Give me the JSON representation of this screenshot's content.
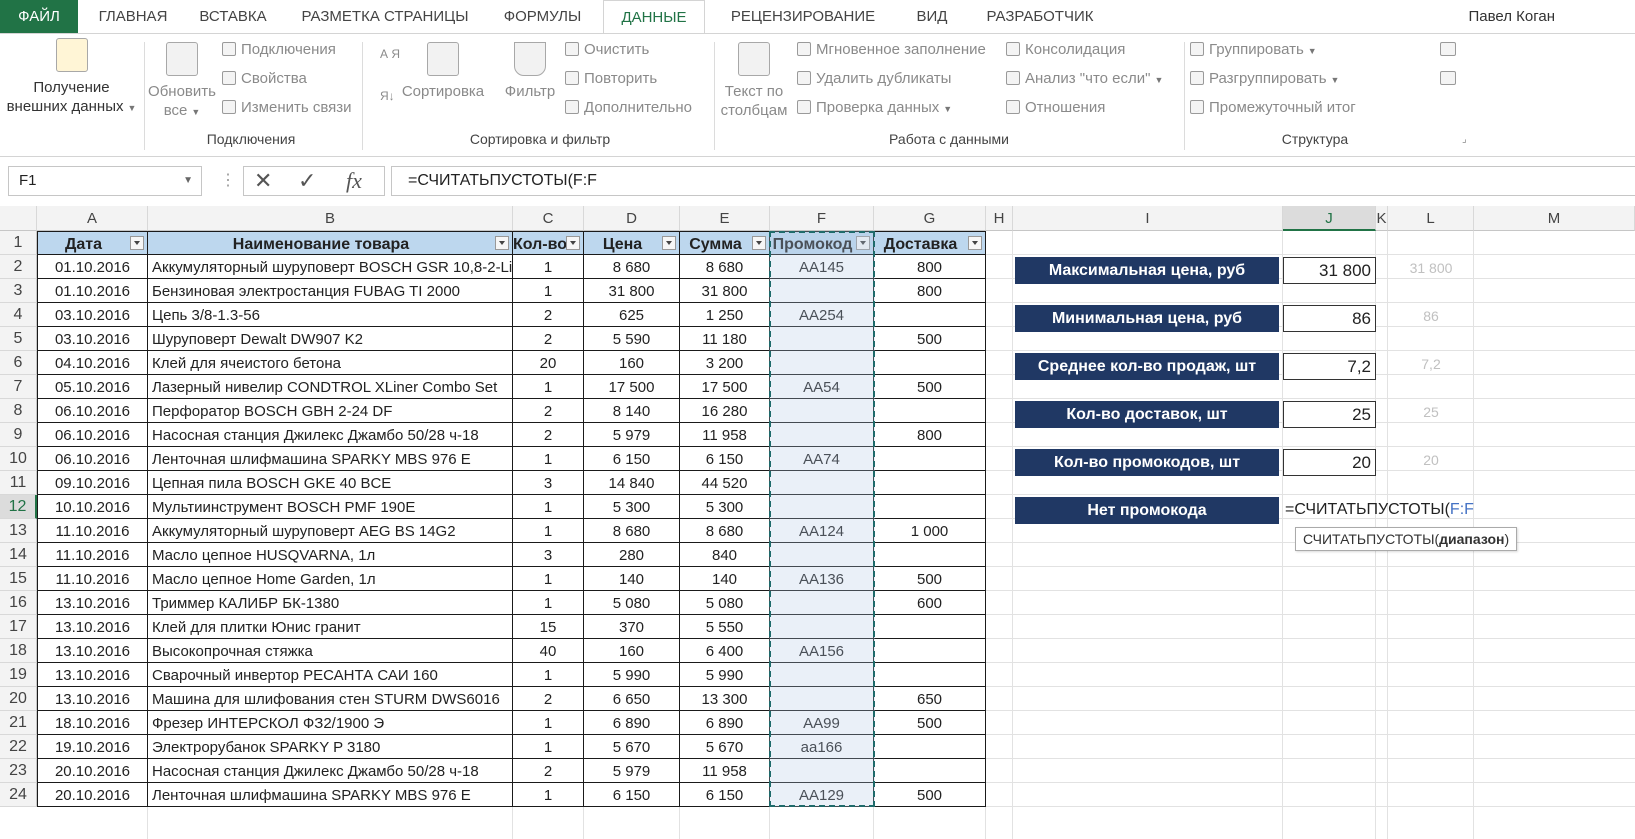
{
  "tabs": [
    "ФАЙЛ",
    "ГЛАВНАЯ",
    "ВСТАВКА",
    "РАЗМЕТКА СТРАНИЦЫ",
    "ФОРМУЛЫ",
    "ДАННЫЕ",
    "РЕЦЕНЗИРОВАНИЕ",
    "ВИД",
    "РАЗРАБОТЧИК"
  ],
  "active_tab": "ДАННЫЕ",
  "user_name": "Павел Коган",
  "ribbon": {
    "get_external_line1": "Получение",
    "get_external_line2": "внешних данных",
    "refresh_line1": "Обновить",
    "refresh_line2": "все",
    "connections": "Подключения",
    "properties": "Свойства",
    "edit_links": "Изменить связи",
    "group_connections": "Подключения",
    "sort_az": "А Я",
    "sort_btn": "Сортировка",
    "filter_btn": "Фильтр",
    "clear": "Очистить",
    "reapply": "Повторить",
    "advanced": "Дополнительно",
    "group_sort_filter": "Сортировка и фильтр",
    "text_to_cols_line1": "Текст по",
    "text_to_cols_line2": "столбцам",
    "flash_fill": "Мгновенное заполнение",
    "remove_dupes": "Удалить дубликаты",
    "data_validation": "Проверка данных",
    "consolidate": "Консолидация",
    "what_if": "Анализ \"что если\"",
    "relationships": "Отношения",
    "group_data_tools": "Работа с данными",
    "group_btn": "Группировать",
    "ungroup_btn": "Разгруппировать",
    "subtotal": "Промежуточный итог",
    "group_outline": "Структура"
  },
  "name_box": "F1",
  "formula": "=СЧИТАТЬПУСТОТЫ(F:F",
  "columns": [
    "A",
    "B",
    "C",
    "D",
    "E",
    "F",
    "G",
    "H",
    "I",
    "J",
    "K",
    "L",
    "M"
  ],
  "selected_column": "J",
  "selected_row": "12",
  "row_numbers": [
    "1",
    "2",
    "3",
    "4",
    "5",
    "6",
    "7",
    "8",
    "9",
    "10",
    "11",
    "12",
    "13",
    "14",
    "15",
    "16",
    "17",
    "18",
    "19",
    "20",
    "21",
    "22",
    "23",
    "24"
  ],
  "table_headers": [
    "Дата",
    "Наименование товара",
    "Кол-во",
    "Цена",
    "Сумма",
    "Промокод",
    "Доставка"
  ],
  "rows": [
    [
      "01.10.2016",
      "Аккумуляторный шуруповерт BOSCH GSR 10,8-2-Li",
      "1",
      "8 680",
      "8 680",
      "AA145",
      "800"
    ],
    [
      "01.10.2016",
      "Бензиновая электростанция FUBAG TI 2000",
      "1",
      "31 800",
      "31 800",
      "",
      "800"
    ],
    [
      "03.10.2016",
      "Цепь 3/8-1.3-56",
      "2",
      "625",
      "1 250",
      "AA254",
      ""
    ],
    [
      "03.10.2016",
      "Шуруповерт Dewalt DW907 K2",
      "2",
      "5 590",
      "11 180",
      "",
      "500"
    ],
    [
      "04.10.2016",
      "Клей для ячеистого бетона",
      "20",
      "160",
      "3 200",
      "",
      ""
    ],
    [
      "05.10.2016",
      "Лазерный нивелир CONDTROL XLiner Combo Set",
      "1",
      "17 500",
      "17 500",
      "AA54",
      "500"
    ],
    [
      "06.10.2016",
      "Перфоратор BOSCH GBH 2-24 DF",
      "2",
      "8 140",
      "16 280",
      "",
      ""
    ],
    [
      "06.10.2016",
      "Насосная станция Джилекс Джамбо 50/28 ч-18",
      "2",
      "5 979",
      "11 958",
      "",
      "800"
    ],
    [
      "06.10.2016",
      "Ленточная шлифмашина SPARKY MBS 976 E",
      "1",
      "6 150",
      "6 150",
      "AA74",
      ""
    ],
    [
      "09.10.2016",
      "Цепная пила BOSCH GKE 40 BCE",
      "3",
      "14 840",
      "44 520",
      "",
      ""
    ],
    [
      "10.10.2016",
      "Мультиинструмент BOSCH PMF 190E",
      "1",
      "5 300",
      "5 300",
      "",
      ""
    ],
    [
      "11.10.2016",
      "Аккумуляторный шуруповерт AEG BS 14G2",
      "1",
      "8 680",
      "8 680",
      "AA124",
      "1 000"
    ],
    [
      "11.10.2016",
      "Масло цепное HUSQVARNA, 1л",
      "3",
      "280",
      "840",
      "",
      ""
    ],
    [
      "11.10.2016",
      "Масло цепное Home Garden, 1л",
      "1",
      "140",
      "140",
      "AA136",
      "500"
    ],
    [
      "13.10.2016",
      "Триммер КАЛИБР БК-1380",
      "1",
      "5 080",
      "5 080",
      "",
      "600"
    ],
    [
      "13.10.2016",
      "Клей для плитки Юнис гранит",
      "15",
      "370",
      "5 550",
      "",
      ""
    ],
    [
      "13.10.2016",
      "Высокопрочная стяжка",
      "40",
      "160",
      "6 400",
      "AA156",
      ""
    ],
    [
      "13.10.2016",
      "Сварочный инвертор РЕСАНТА САИ 160",
      "1",
      "5 990",
      "5 990",
      "",
      ""
    ],
    [
      "13.10.2016",
      "Машина для шлифования стен STURM DWS6016",
      "2",
      "6 650",
      "13 300",
      "",
      "650"
    ],
    [
      "18.10.2016",
      "Фрезер ИНТЕРСКОЛ ФЗ2/1900 Э",
      "1",
      "6 890",
      "6 890",
      "AA99",
      "500"
    ],
    [
      "19.10.2016",
      "Электрорубанок SPARKY P 3180",
      "1",
      "5 670",
      "5 670",
      "аа166",
      ""
    ],
    [
      "20.10.2016",
      "Насосная станция Джилекс Джамбо 50/28 ч-18",
      "2",
      "5 979",
      "11 958",
      "",
      ""
    ],
    [
      "20.10.2016",
      "Ленточная шлифмашина SPARKY MBS 976 E",
      "1",
      "6 150",
      "6 150",
      "AA129",
      "500"
    ]
  ],
  "stats": [
    {
      "label": "Максимальная цена, руб",
      "value": "31 800",
      "ghost": "31 800"
    },
    {
      "label": "Минимальная цена, руб",
      "value": "86",
      "ghost": "86"
    },
    {
      "label": "Среднее кол-во продаж, шт",
      "value": "7,2",
      "ghost": "7,2"
    },
    {
      "label": "Кол-во доставок, шт",
      "value": "25",
      "ghost": "25"
    },
    {
      "label": "Кол-во промокодов, шт",
      "value": "20",
      "ghost": "20"
    },
    {
      "label": "Нет промокода",
      "value": "",
      "ghost": ""
    }
  ],
  "edit_cell": {
    "prefix": "=СЧИТАТЬПУСТОТЫ(",
    "ref": "F:F"
  },
  "tooltip": {
    "func": "СЧИТАТЬПУСТОТЫ(",
    "arg": "диапазон",
    "close": ")"
  }
}
